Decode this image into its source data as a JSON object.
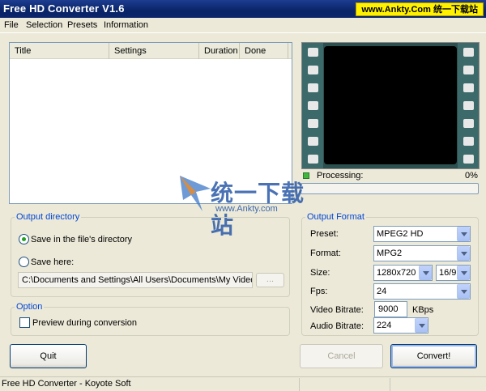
{
  "window": {
    "title": "Free HD Converter V1.6",
    "watermark": "www.Ankty.Com 统一下载站"
  },
  "menu": [
    "File",
    "Selection",
    "Presets",
    "Information"
  ],
  "list": {
    "columns": [
      "Title",
      "Settings",
      "Duration",
      "Done"
    ]
  },
  "processing": {
    "label": "Processing:",
    "percent": "0%",
    "progress": 0
  },
  "logo": {
    "text": "统一下载站",
    "url": "www.Ankty.com"
  },
  "output_directory": {
    "legend": "Output directory",
    "option_files_dir": "Save in the file's directory",
    "option_save_here": "Save here:",
    "selected": "files_dir",
    "path": "C:\\Documents and Settings\\All Users\\Documents\\My Videos",
    "browse_label": "..."
  },
  "option": {
    "legend": "Option",
    "preview_label": "Preview during conversion",
    "preview_checked": false
  },
  "output_format": {
    "legend": "Output Format",
    "preset_label": "Preset:",
    "preset_value": "MPEG2 HD",
    "format_label": "Format:",
    "format_value": "MPG2",
    "size_label": "Size:",
    "size_value": "1280x720",
    "aspect_value": "16/9",
    "fps_label": "Fps:",
    "fps_value": "24",
    "video_bitrate_label": "Video Bitrate:",
    "video_bitrate_value": "9000",
    "video_bitrate_unit": "KBps",
    "audio_bitrate_label": "Audio Bitrate:",
    "audio_bitrate_value": "224"
  },
  "buttons": {
    "quit": "Quit",
    "cancel": "Cancel",
    "convert": "Convert!"
  },
  "status": {
    "text": "Free HD Converter - Koyote Soft"
  },
  "colors": {
    "titlebar": "#0b246a",
    "legend": "#0046d5",
    "watermark_bg": "#fff200",
    "led": "#3fb83f"
  }
}
